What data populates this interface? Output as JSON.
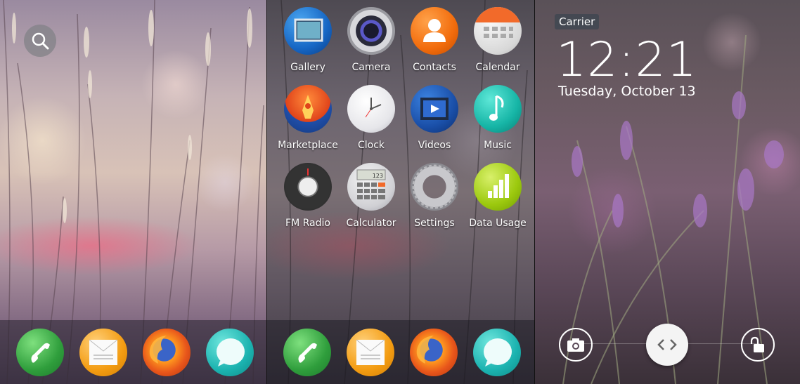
{
  "homescreen": {
    "search_icon": "search-icon",
    "dock": [
      {
        "name": "phone-icon"
      },
      {
        "name": "email-icon"
      },
      {
        "name": "firefox-icon"
      },
      {
        "name": "messages-icon"
      }
    ]
  },
  "app_grid": {
    "apps": [
      {
        "label": "Gallery",
        "icon": "gallery-icon"
      },
      {
        "label": "Camera",
        "icon": "camera-icon"
      },
      {
        "label": "Contacts",
        "icon": "contacts-icon"
      },
      {
        "label": "Calendar",
        "icon": "calendar-icon"
      },
      {
        "label": "Marketplace",
        "icon": "marketplace-icon"
      },
      {
        "label": "Clock",
        "icon": "clock-icon"
      },
      {
        "label": "Videos",
        "icon": "videos-icon"
      },
      {
        "label": "Music",
        "icon": "music-icon"
      },
      {
        "label": "FM Radio",
        "icon": "fm-radio-icon"
      },
      {
        "label": "Calculator",
        "icon": "calculator-icon"
      },
      {
        "label": "Settings",
        "icon": "settings-icon"
      },
      {
        "label": "Data Usage",
        "icon": "data-usage-icon"
      }
    ],
    "calculator_display": "123"
  },
  "lockscreen": {
    "carrier": "Carrier",
    "time": "12:21",
    "date": "Tuesday, October 13",
    "camera_icon": "camera-icon",
    "slider_icon": "slider-arrows-icon",
    "unlock_icon": "unlock-icon"
  },
  "colors": {
    "phone": "#3cb44a",
    "email": "#f39c12",
    "firefox": "#e8561b",
    "messages": "#1bb3b0",
    "carrier_bg": "#3c4650"
  }
}
